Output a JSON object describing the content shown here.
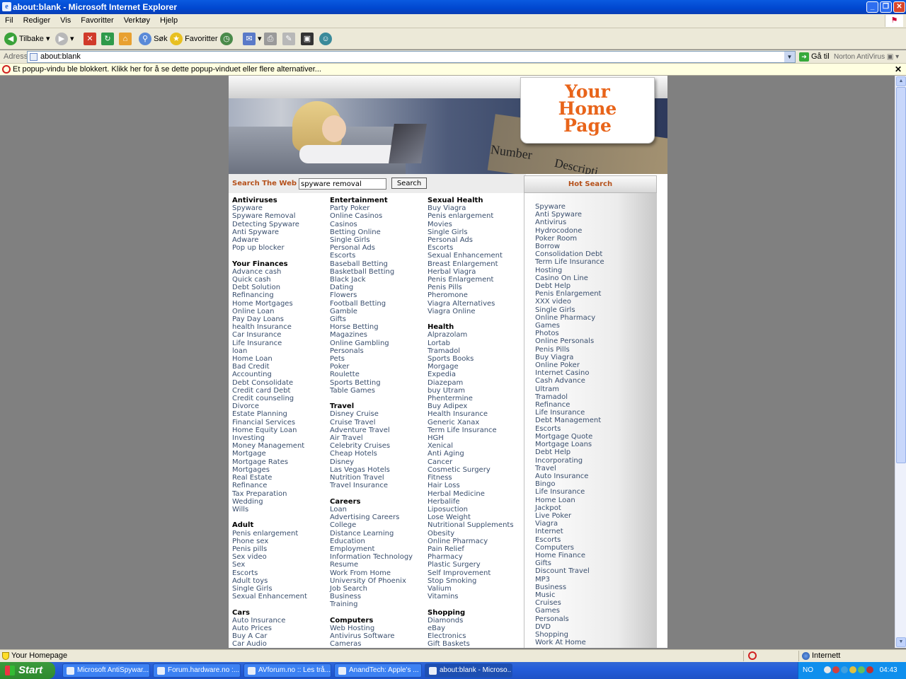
{
  "window": {
    "title": "about:blank - Microsoft Internet Explorer"
  },
  "menu": [
    "Fil",
    "Rediger",
    "Vis",
    "Favoritter",
    "Verktøy",
    "Hjelp"
  ],
  "toolbar": {
    "back": "Tilbake",
    "search": "Søk",
    "favorites": "Favoritter"
  },
  "address": {
    "label": "Adresse",
    "value": "about:blank",
    "go": "Gå til",
    "norton": "Norton AntiVirus"
  },
  "infobar": {
    "text": "Et popup-vindu ble blokkert. Klikk her for å se dette popup-vinduet eller flere alternativer..."
  },
  "page": {
    "logo": [
      "Your",
      "Home",
      "Page"
    ],
    "banner_words": [
      "Number",
      "Descripti"
    ],
    "search": {
      "label": "Search The Web",
      "value": "spyware removal",
      "button": "Search"
    },
    "hot_title": "Hot Search",
    "columns": [
      [
        {
          "title": "Antiviruses",
          "links": [
            "Spyware",
            "Spyware Removal",
            "Detecting Spyware",
            "Anti Spyware",
            "Adware",
            "Pop up blocker"
          ]
        },
        {
          "title": "Your Finances",
          "links": [
            "Advance cash",
            "Quick cash",
            "Debt Solution",
            "Refinancing",
            "Home Mortgages",
            "Online Loan",
            "Pay Day Loans",
            "health Insurance",
            "Car Insurance",
            "Life Insurance",
            "loan",
            "Home Loan",
            "Bad Credit",
            "Accounting",
            "Debt Consolidate",
            "Credit card Debt",
            "Credit counseling",
            "Divorce",
            "Estate Planning",
            "Financial Services",
            "Home Equity Loan",
            "Investing",
            "Money Management",
            "Mortgage",
            "Mortgage Rates",
            "Mortgages",
            "Real Estate",
            "Refinance",
            "Tax Preparation",
            "Wedding",
            "Wills"
          ]
        },
        {
          "title": "Adult",
          "links": [
            "Penis enlargement",
            "Phone sex",
            "Penis pills",
            "Sex video",
            "Sex",
            "Escorts",
            "Adult toys",
            "Single Girls",
            "Sexual Enhancement"
          ]
        },
        {
          "title": "Cars",
          "links": [
            "Auto Insurance",
            "Auto Prices",
            "Buy A Car",
            "Car Audio"
          ]
        }
      ],
      [
        {
          "title": "Entertainment",
          "links": [
            "Party Poker",
            "Online Casinos",
            "Casinos",
            "Betting Online",
            "Single Girls",
            "Personal Ads",
            "Escorts",
            "Baseball Betting",
            "Basketball Betting",
            "Black Jack",
            "Dating",
            "Flowers",
            "Football Betting",
            "Gamble",
            "Gifts",
            "Horse Betting",
            "Magazines",
            "Online Gambling",
            "Personals",
            "Pets",
            "Poker",
            "Roulette",
            "Sports Betting",
            "Table Games"
          ]
        },
        {
          "title": "Travel",
          "links": [
            "Disney Cruise",
            "Cruise Travel",
            "Adventure Travel",
            "Air Travel",
            "Celebrity Cruises",
            "Cheap Hotels",
            "Disney",
            "Las Vegas Hotels",
            "Nutrition Travel",
            "Travel Insurance"
          ]
        },
        {
          "title": "Careers",
          "links": [
            "Loan",
            "Advertising Careers",
            "College",
            "Distance Learning",
            "Education",
            "Employment",
            "Information Technology",
            "Resume",
            "Work From Home",
            "University Of Phoenix",
            "Job Search",
            "Business",
            "Training"
          ]
        },
        {
          "title": "Computers",
          "links": [
            "Web Hosting",
            "Antivirus Software",
            "Cameras"
          ]
        }
      ],
      [
        {
          "title": "Sexual Health",
          "links": [
            "Buy Viagra",
            "Penis enlargement",
            "Movies",
            "Single Girls",
            "Personal Ads",
            "Escorts",
            "Sexual Enhancement",
            "Breast Enlargement",
            "Herbal Viagra",
            "Penis Enlargement",
            "Penis Pills",
            "Pheromone",
            "Viagra Alternatives",
            "Viagra Online"
          ]
        },
        {
          "title": "Health",
          "links": [
            "Alprazolam",
            "Lortab",
            "Tramadol",
            "Sports Books",
            "Morgage",
            "Expedia",
            "Diazepam",
            "buy Utram",
            "Phentermine",
            "Buy Adipex",
            "Health Insurance",
            "Generic Xanax",
            "Term Life Insurance",
            "HGH",
            "Xenical",
            "Anti Aging",
            "Cancer",
            "Cosmetic Surgery",
            "Fitness",
            "Hair Loss",
            "Herbal Medicine",
            "Herbalife",
            "Liposuction",
            "Lose Weight",
            "Nutritional Supplements",
            "Obesity",
            "Online Pharmacy",
            "Pain Relief",
            "Pharmacy",
            "Plastic Surgery",
            "Self Improvement",
            "Stop Smoking",
            "Valium",
            "Vitamins"
          ]
        },
        {
          "title": "Shopping",
          "links": [
            "Diamonds",
            "eBay",
            "Electronics",
            "Gift Baskets"
          ]
        }
      ]
    ],
    "hot_links": [
      "Spyware",
      "Anti Spyware",
      "Antivirus",
      "Hydrocodone",
      "Poker Room",
      "Borrow",
      "Consolidation Debt",
      "Term Life Insurance",
      "Hosting",
      "Casino On Line",
      "Debt Help",
      "Penis Enlargement",
      "XXX video",
      "Single Girls",
      "Online Pharmacy",
      "Games",
      "Photos",
      "Online Personals",
      "Penis Pills",
      "Buy Viagra",
      "Online Poker",
      "Internet Casino",
      "Cash Advance",
      "Ultram",
      "Tramadol",
      "Refinance",
      "Life Insurance",
      "Debt Management",
      "Escorts",
      "Mortgage Quote",
      "Mortgage Loans",
      "Debt Help",
      "Incorporating",
      "Travel",
      "Auto Insurance",
      "Bingo",
      "Life Insurance",
      "Home Loan",
      "Jackpot",
      "Live Poker",
      "Viagra",
      "Internet",
      "Escorts",
      "Computers",
      "Home Finance",
      "Gifts",
      "Discount Travel",
      "MP3",
      "Business",
      "Music",
      "Cruises",
      "Games",
      "Personals",
      "DVD",
      "Shopping",
      "Work At Home"
    ]
  },
  "statusbar": {
    "text": "Your Homepage",
    "zone": "Internett"
  },
  "taskbar": {
    "start": "Start",
    "tasks": [
      "Microsoft AntiSpywar...",
      "Forum.hardware.no :...",
      "AVforum.no :: Les trå...",
      "AnandTech: Apple's ...",
      "about:blank - Microso..."
    ],
    "lang": "NO",
    "clock": "04:43"
  }
}
